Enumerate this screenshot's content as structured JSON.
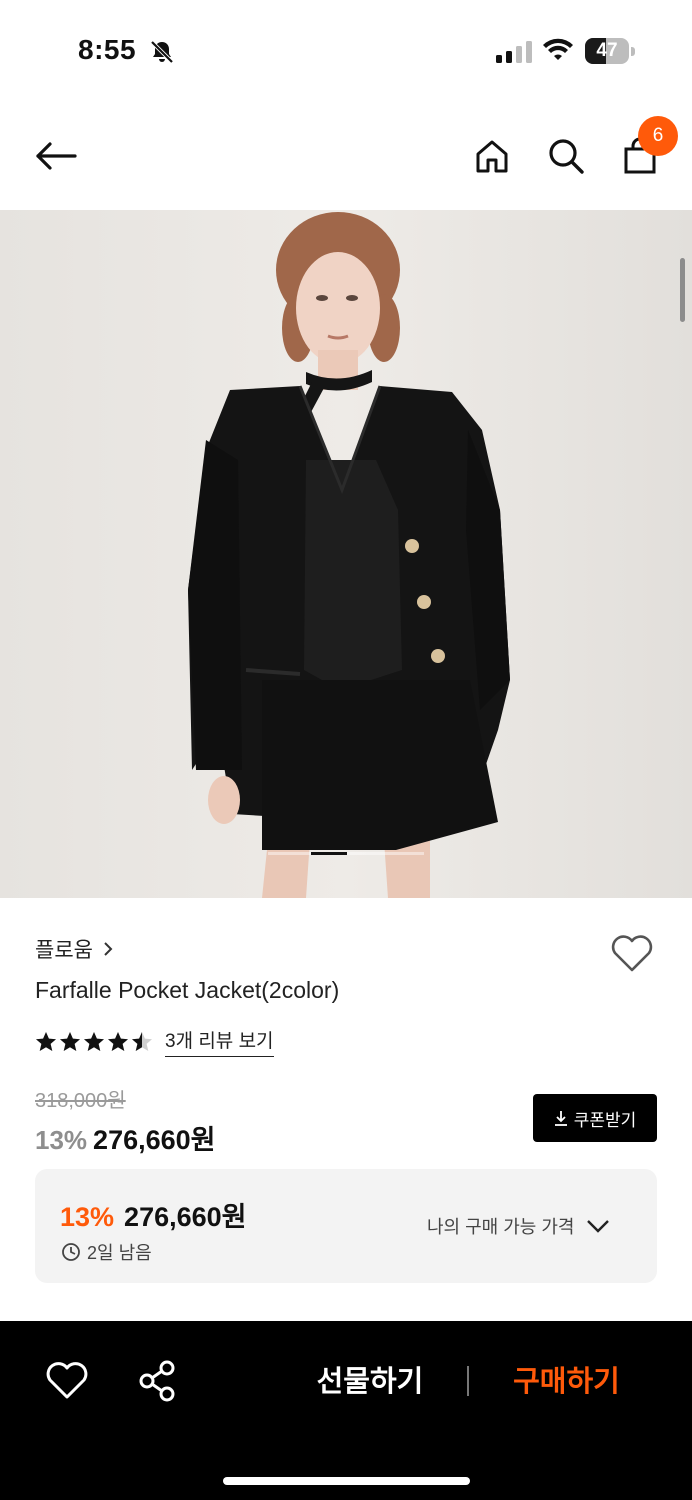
{
  "status_bar": {
    "time": "8:55",
    "battery": "47",
    "battery_level": 0.47
  },
  "nav": {
    "cart_count": "6"
  },
  "product": {
    "brand": "플로움",
    "title": "Farfalle Pocket Jacket(2color)",
    "rating": 4.5,
    "review_link": "3개 리뷰 보기",
    "original_price": "318,000원",
    "discount": "13%",
    "price": "276,660원",
    "coupon_button": "쿠폰받기"
  },
  "best_price": {
    "discount": "13%",
    "price": "276,660원",
    "time_left": "2일 남음",
    "my_price_label": "나의 구매 가능 가격"
  },
  "gallery": {
    "scroll_position": 0.04
  },
  "bottom_bar": {
    "gift_label": "선물하기",
    "buy_label": "구매하기"
  },
  "colors": {
    "accent": "#ff5a0a",
    "bar": "#000000"
  }
}
